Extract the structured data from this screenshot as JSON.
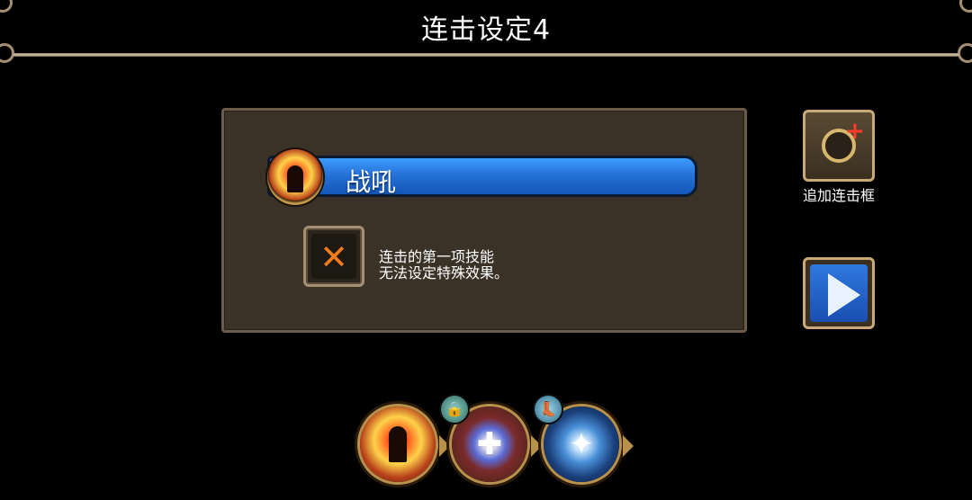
{
  "header": {
    "title": "连击设定4"
  },
  "panel": {
    "skill_name": "战吼",
    "info_line1": "连击的第一项技能",
    "info_line2": "无法设定特殊效果。",
    "remove_icon": "x-icon"
  },
  "sidebar": {
    "add_frame_label": "追加连击框",
    "add_frame_icon": "ring-plus-icon",
    "play_icon": "play-icon"
  },
  "chain": {
    "skills": [
      {
        "icon": "roar-skill-icon"
      },
      {
        "icon": "shield-skill-icon",
        "badge": "lock-badge-icon"
      },
      {
        "icon": "wings-skill-icon",
        "badge": "boot-badge-icon"
      }
    ]
  },
  "colors": {
    "bar_blue": "#2673d8",
    "panel_bg": "#3a3226",
    "gold_border": "#c8a978",
    "x_orange": "#f07a1c"
  }
}
